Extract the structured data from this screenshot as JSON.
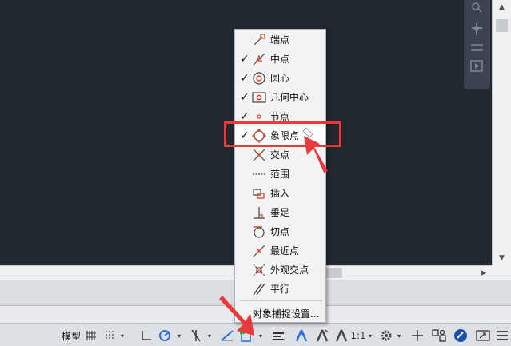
{
  "menu": {
    "items": [
      {
        "label": "端点",
        "checked": false,
        "icon": "endpoint-snap-icon"
      },
      {
        "label": "中点",
        "checked": true,
        "icon": "midpoint-snap-icon"
      },
      {
        "label": "圆心",
        "checked": true,
        "icon": "center-snap-icon"
      },
      {
        "label": "几何中心",
        "checked": true,
        "icon": "geometric-center-snap-icon"
      },
      {
        "label": "节点",
        "checked": true,
        "icon": "node-snap-icon"
      },
      {
        "label": "象限点",
        "checked": true,
        "icon": "quadrant-snap-icon"
      },
      {
        "label": "交点",
        "checked": false,
        "icon": "intersection-snap-icon"
      },
      {
        "label": "范围",
        "checked": false,
        "icon": "extension-snap-icon"
      },
      {
        "label": "插入",
        "checked": false,
        "icon": "insertion-snap-icon"
      },
      {
        "label": "垂足",
        "checked": false,
        "icon": "perpendicular-snap-icon"
      },
      {
        "label": "切点",
        "checked": false,
        "icon": "tangent-snap-icon"
      },
      {
        "label": "最近点",
        "checked": false,
        "icon": "nearest-snap-icon"
      },
      {
        "label": "外观交点",
        "checked": false,
        "icon": "apparent-intersection-snap-icon"
      },
      {
        "label": "平行",
        "checked": false,
        "icon": "parallel-snap-icon"
      }
    ],
    "check_mark": "✓",
    "settings_label": "对象捕捉设置..."
  },
  "statusbar": {
    "model_label": "模型",
    "scale_label": "1:1",
    "caret": "▾"
  },
  "scroll": {
    "up": "▲",
    "down": "▼",
    "left": "◀",
    "right": "▶"
  },
  "colors": {
    "canvas": "#212830",
    "highlight": "#e8393b",
    "accent_blue": "#2f6fd6",
    "snap_icon": "#d24a2a"
  }
}
